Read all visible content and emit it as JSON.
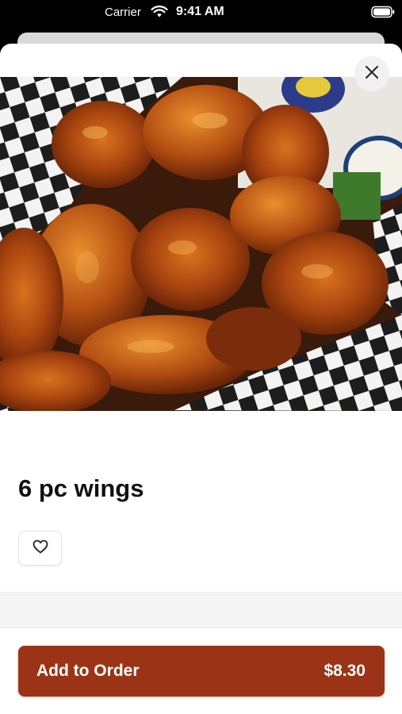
{
  "status_bar": {
    "carrier": "Carrier",
    "time": "9:41 AM",
    "icons": [
      "wifi-icon",
      "battery-icon"
    ]
  },
  "modal": {
    "close_icon": "close-icon",
    "image_alt": "Basket of glazed chicken wings on checkered paper",
    "item": {
      "title": "6 pc wings",
      "favorite_icon": "heart-icon"
    },
    "footer": {
      "add_label": "Add to Order",
      "price": "$8.30"
    }
  },
  "colors": {
    "accent": "#9b3416",
    "background": "#ffffff",
    "band": "#f5f5f5"
  }
}
